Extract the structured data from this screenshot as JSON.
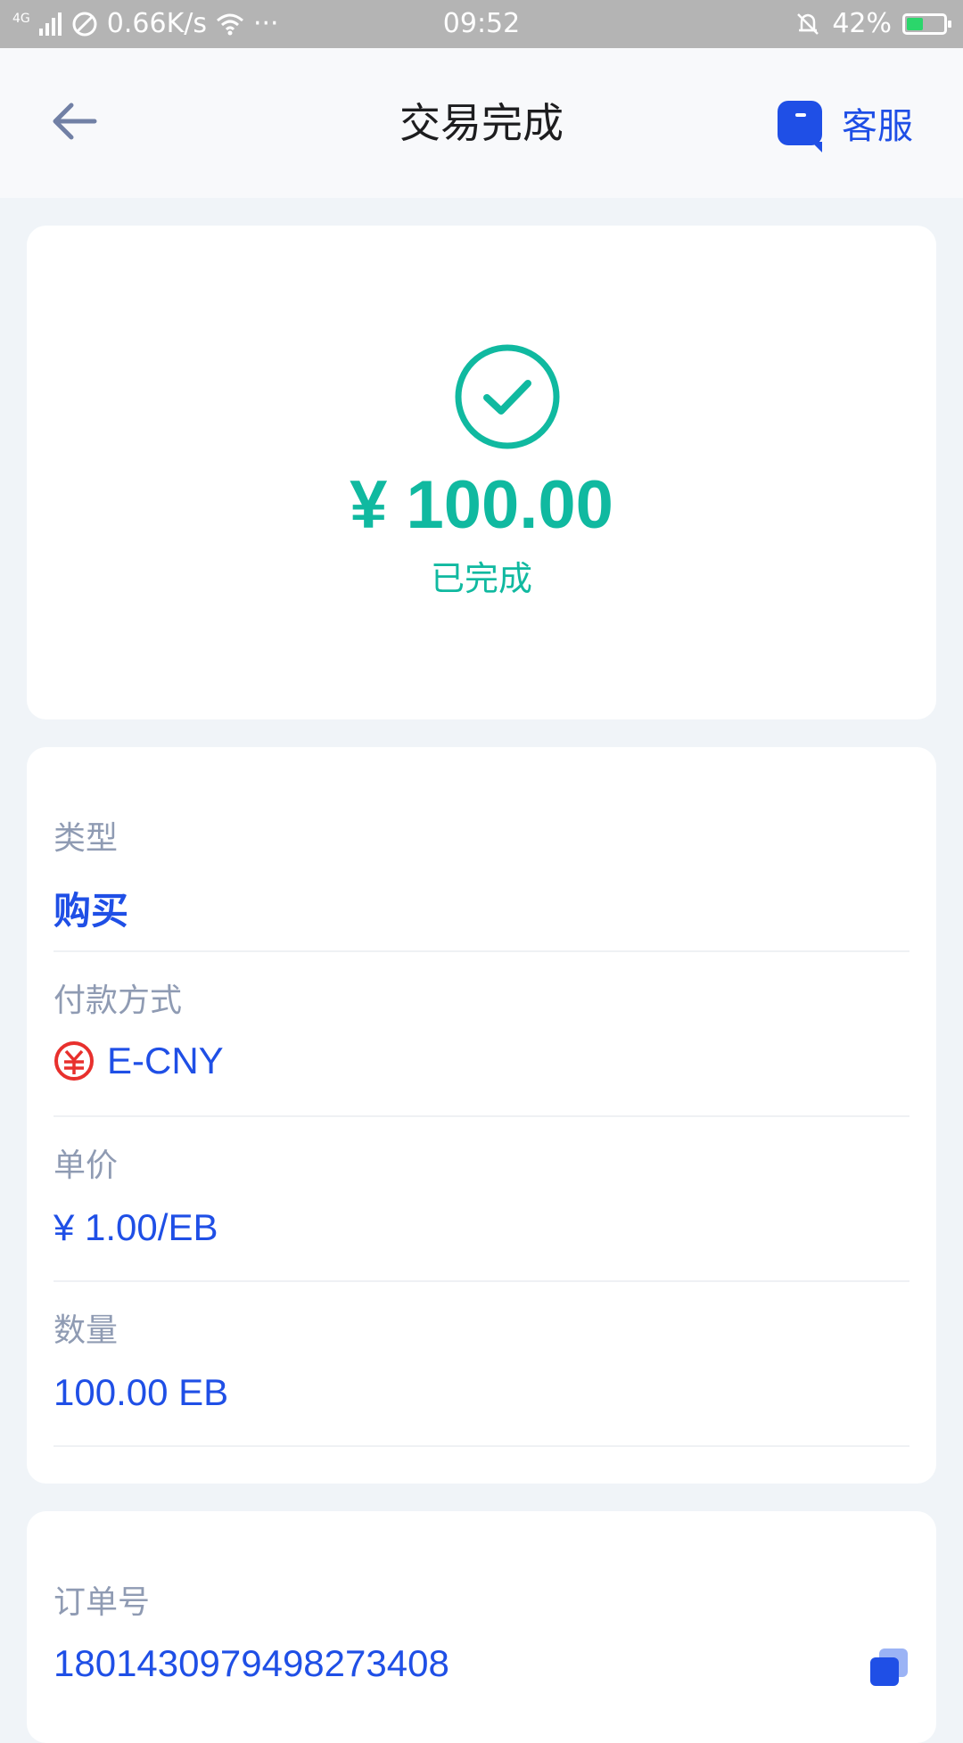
{
  "status_bar": {
    "network": "4G",
    "speed": "0.66K/s",
    "dots": "···",
    "time": "09:52",
    "battery": "42%"
  },
  "header": {
    "title": "交易完成",
    "service_label": "客服"
  },
  "status_card": {
    "amount": "¥ 100.00",
    "status": "已完成"
  },
  "info": {
    "type_label": "类型",
    "type_value": "购买",
    "payment_label": "付款方式",
    "payment_value": "E-CNY",
    "price_label": "单价",
    "price_value": "¥ 1.00/EB",
    "quantity_label": "数量",
    "quantity_value": "100.00 EB"
  },
  "order": {
    "label": "订单号",
    "number": "1801430979498273408"
  },
  "colors": {
    "accent_blue": "#1f4fe6",
    "success_teal": "#10b9a0",
    "label_gray": "#8f9bb3",
    "ecny_red": "#e8302d"
  }
}
